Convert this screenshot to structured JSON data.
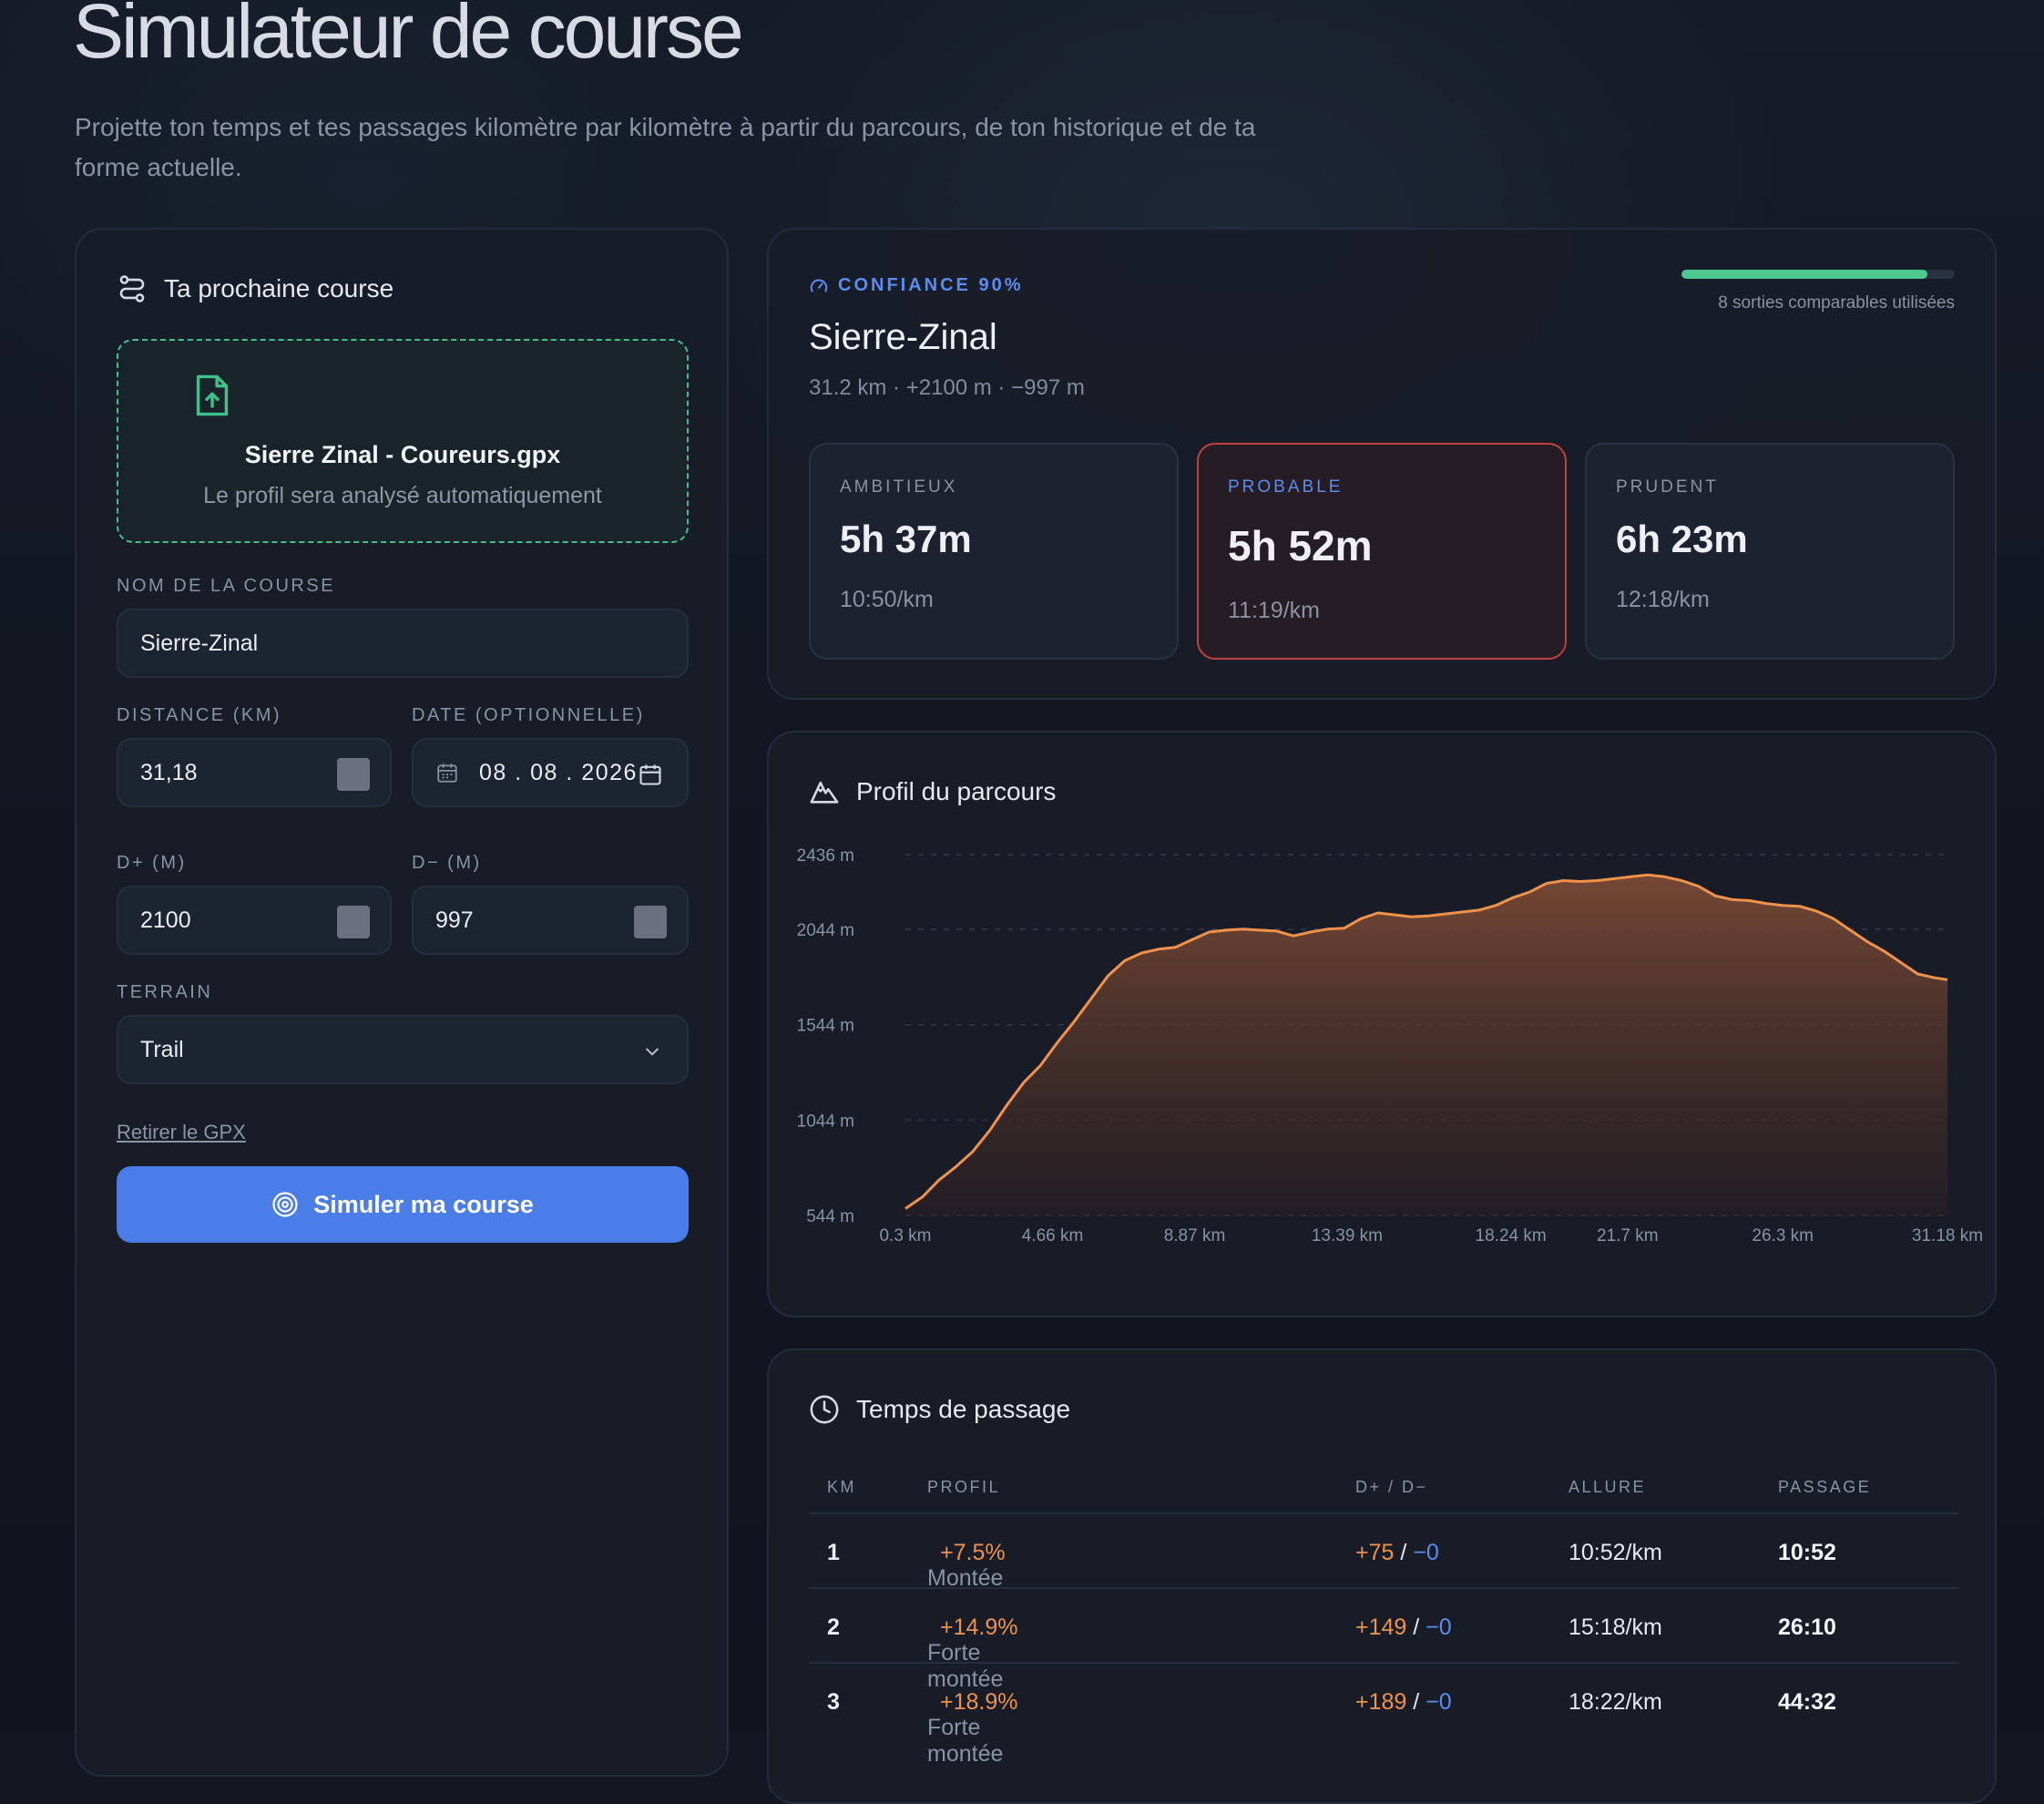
{
  "header": {
    "title": "Simulateur de course",
    "subtitle": "Projette ton temps et tes passages kilomètre par kilomètre à partir du parcours, de ton historique et de ta forme actuelle."
  },
  "form": {
    "heading": "Ta prochaine course",
    "upload": {
      "file_name": "Sierre Zinal - Coureurs.gpx",
      "hint": "Le profil sera analysé automatiquement"
    },
    "race_name": {
      "label": "NOM DE LA COURSE",
      "value": "Sierre-Zinal"
    },
    "distance": {
      "label": "DISTANCE (KM)",
      "value": "31,18"
    },
    "date": {
      "label": "DATE (OPTIONNELLE)",
      "value": "08 . 08 . 2026"
    },
    "d_plus": {
      "label": "D+ (M)",
      "value": "2100"
    },
    "d_minus": {
      "label": "D− (M)",
      "value": "997"
    },
    "terrain": {
      "label": "TERRAIN",
      "value": "Trail"
    },
    "remove_gpx": "Retirer le GPX",
    "simulate_button": "Simuler ma course"
  },
  "result": {
    "confidence": "CONFIANCE 90%",
    "confidence_fraction": 0.9,
    "comparable_runs": "8 sorties comparables utilisées",
    "race_name": "Sierre-Zinal",
    "race_meta": "31.2 km · +2100 m · −997 m",
    "scenarios": [
      {
        "label": "AMBITIEUX",
        "time": "5h 37m",
        "pace": "10:50/km"
      },
      {
        "label": "PROBABLE",
        "time": "5h 52m",
        "pace": "11:19/km"
      },
      {
        "label": "PRUDENT",
        "time": "6h 23m",
        "pace": "12:18/km"
      }
    ]
  },
  "profile": {
    "heading": "Profil du parcours"
  },
  "chart_data": {
    "type": "area",
    "title": "Profil du parcours",
    "xlabel": "",
    "ylabel": "",
    "y_ticks": [
      "2436 m",
      "2044 m",
      "1544 m",
      "1044 m",
      "544 m"
    ],
    "x_ticks": [
      "0.3 km",
      "4.66 km",
      "8.87 km",
      "13.39 km",
      "18.24 km",
      "21.7 km",
      "26.3 km",
      "31.18 km"
    ],
    "ylim": [
      544,
      2436
    ],
    "xlim": [
      0.3,
      31.18
    ],
    "x": [
      0.3,
      0.8,
      1.3,
      1.8,
      2.3,
      2.8,
      3.3,
      3.8,
      4.3,
      4.8,
      5.3,
      5.8,
      6.3,
      6.8,
      7.3,
      7.8,
      8.3,
      8.8,
      9.3,
      9.8,
      10.3,
      10.8,
      11.3,
      11.8,
      12.3,
      12.8,
      13.3,
      13.8,
      14.3,
      14.8,
      15.3,
      15.8,
      16.3,
      16.8,
      17.3,
      17.8,
      18.3,
      18.8,
      19.3,
      19.8,
      20.3,
      20.8,
      21.3,
      21.8,
      22.3,
      22.8,
      23.3,
      23.8,
      24.3,
      24.8,
      25.3,
      25.8,
      26.3,
      26.8,
      27.3,
      27.8,
      28.3,
      28.8,
      29.3,
      29.8,
      30.3,
      30.8,
      31.18
    ],
    "values": [
      580,
      640,
      730,
      800,
      880,
      990,
      1120,
      1240,
      1330,
      1450,
      1560,
      1680,
      1800,
      1880,
      1920,
      1940,
      1950,
      1990,
      2030,
      2040,
      2045,
      2040,
      2035,
      2010,
      2030,
      2045,
      2050,
      2100,
      2130,
      2120,
      2110,
      2115,
      2125,
      2135,
      2145,
      2170,
      2210,
      2240,
      2285,
      2300,
      2295,
      2300,
      2310,
      2320,
      2330,
      2320,
      2300,
      2270,
      2220,
      2200,
      2195,
      2180,
      2170,
      2165,
      2140,
      2100,
      2040,
      1980,
      1930,
      1870,
      1810,
      1790,
      1780
    ]
  },
  "passages": {
    "heading": "Temps de passage",
    "columns": [
      "KM",
      "PROFIL",
      "D+ / D−",
      "ALLURE",
      "PASSAGE"
    ],
    "rows": [
      {
        "km": "1",
        "profil": "Montée",
        "pct": "+7.5%",
        "dplus": "+75",
        "dminus": "−0",
        "allure": "10:52/km",
        "passage": "10:52"
      },
      {
        "km": "2",
        "profil": "Forte montée",
        "pct": "+14.9%",
        "dplus": "+149",
        "dminus": "−0",
        "allure": "15:18/km",
        "passage": "26:10"
      },
      {
        "km": "3",
        "profil": "Forte montée",
        "pct": "+18.9%",
        "dplus": "+189",
        "dminus": "−0",
        "allure": "18:22/km",
        "passage": "44:32"
      }
    ]
  },
  "colors": {
    "accent": "#4a7de8",
    "upload_border": "#3ec28a",
    "elevation_line": "#f0924a",
    "highlight_border": "#c2403e",
    "progress": "#4cc98e"
  }
}
